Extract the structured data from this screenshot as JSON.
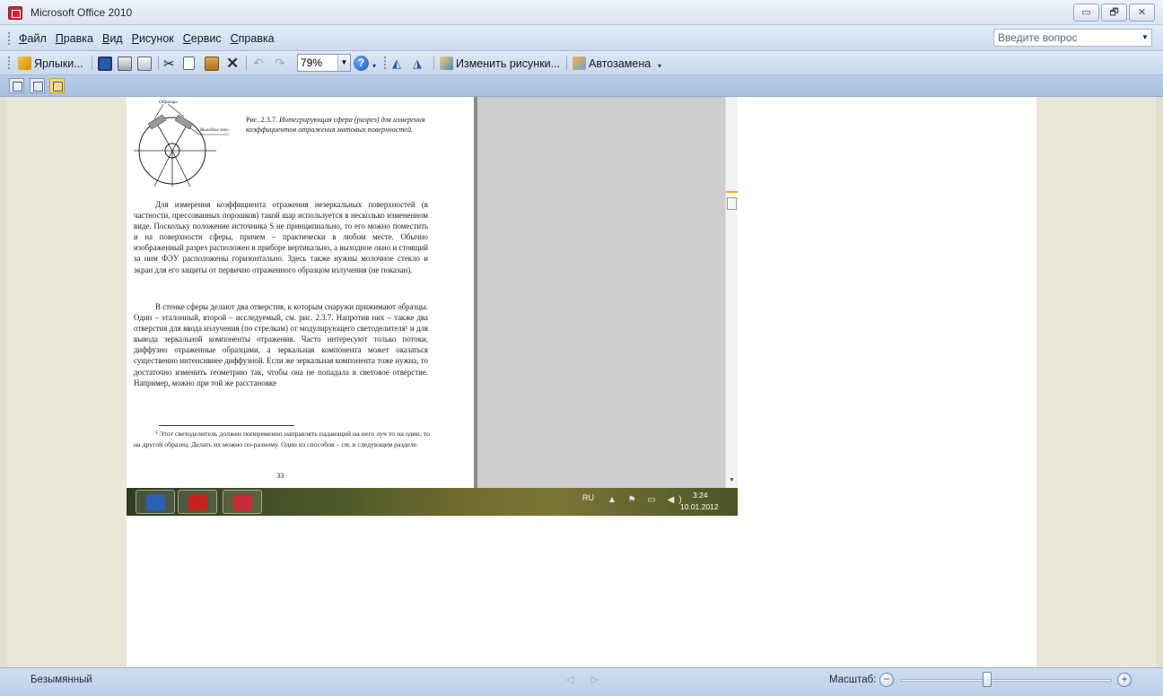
{
  "window": {
    "title": "Microsoft Office 2010",
    "controls": [
      "▭",
      "🗗",
      "✕"
    ]
  },
  "menu": {
    "items": [
      {
        "accel": "Ф",
        "rest": "айл"
      },
      {
        "accel": "П",
        "rest": "равка"
      },
      {
        "accel": "В",
        "rest": "ид"
      },
      {
        "accel": "Р",
        "rest": "исунок"
      },
      {
        "accel": "С",
        "rest": "ервис"
      },
      {
        "accel": "С",
        "rest": "правка"
      }
    ],
    "question_placeholder": "Введите вопрос"
  },
  "toolbar": {
    "shortcuts_label": "Ярлыки...",
    "zoom_value": "79%",
    "edit_pictures_label": "Изменить рисунки...",
    "autocorrect_label": "Автозамена",
    "colors": {
      "accent": "#1d56b8",
      "save": "#2a5aa8",
      "delete": "#333333"
    }
  },
  "document": {
    "figure_label_top": "Образцы",
    "figure_label_side": "Выходное окно",
    "caption_prefix": "Рис. 2.3.7.",
    "caption_text": "Интегрирующая сфера (разрез) для измерения коэффициентов отражения матовых поверхностей.",
    "para1": "Для измерения коэффициента отражения незеркальных поверхностей (в частности, прессованных порошков) такой шар используется в несколько измененном виде. Поскольку положение источника S не принципиально, то его можно поместить и на поверхности сферы, причем – практически в любом месте. Обычно изображенный разрез расположен в приборе вертикально, а выходное окно и стоящий за ним ФЭУ расположены горизонтально. Здесь также нужны молочное стекло и экран для его защиты от первично отраженного образцом излучения (не показан).",
    "para2": "В стенке сферы делают два отверстия, к которым снаружи прижимают образцы. Один – эталонный, второй – исследуемый, см. рис. 2.3.7. Напротив них – также два отверстия для ввода излучения (по стрелкам) от модулирующего светоделителя¹ и для вывода зеркальной компоненты отражения. Часто интересуют только потоки, диффузно отраженные образцами, а зеркальная компонента может оказаться существенно интенсивнее диффузной. Если же зеркальная компонента тоже нужна, то достаточно изменить геометрию так, чтобы она не попадала в световое отверстие. Например, можно при той же расстановке",
    "footnote": "¹ Этот светоделитель должен попеременно направлять падающий на него луч то на один, то на другой образец. Делать их можно по-разному. Один из способов – см. в следующем разделе.",
    "page_number": "33"
  },
  "taskbar": {
    "lang": "RU",
    "tray_icons": "▲ ⚑ ▭ ◀)",
    "time": "3:24",
    "date": "10.01.2012",
    "colors": {
      "word": "#2b5fb4",
      "pdf": "#c8201e",
      "office": "#c8293a"
    }
  },
  "status": {
    "file_name": "Безымянный",
    "zoom_label": "Масштаб:",
    "zoom_minus": "−",
    "zoom_plus": "+",
    "nav_arrows": "◁ ▷",
    "zoom_level": 0.41
  }
}
